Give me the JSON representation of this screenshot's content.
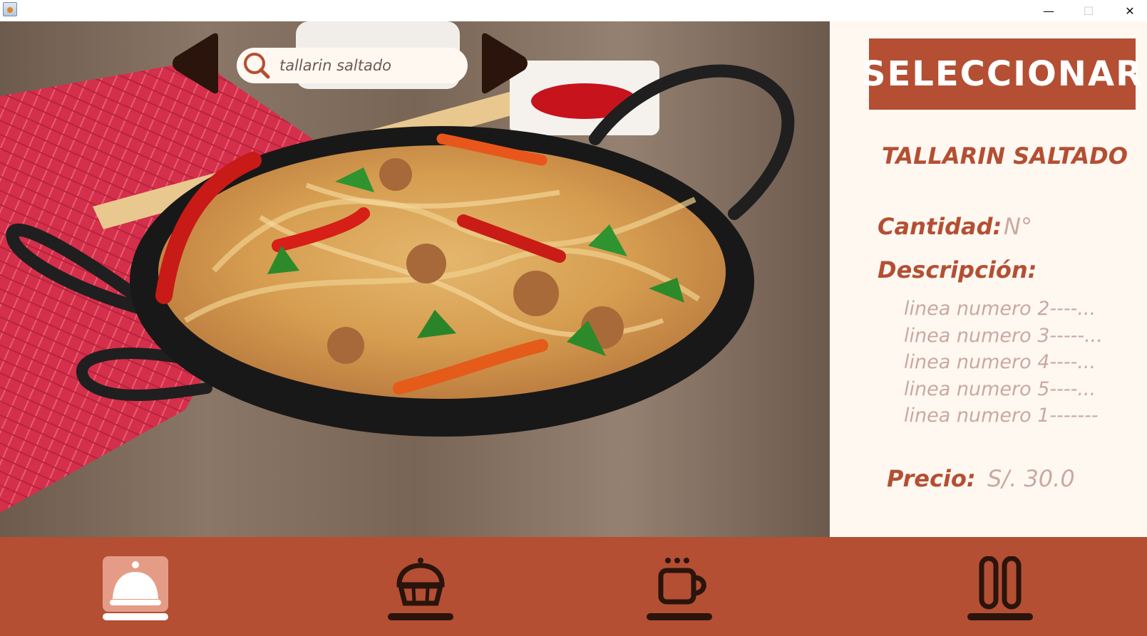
{
  "window": {
    "controls": [
      "minimize",
      "maximize",
      "close"
    ],
    "minimize_glyph": "—",
    "maximize_glyph": "☐",
    "close_glyph": "✕"
  },
  "search": {
    "value": "tallarin saltado",
    "icon": "search-icon"
  },
  "navigation": {
    "prev_icon": "left-arrow-icon",
    "next_icon": "right-arrow-icon"
  },
  "actions": {
    "select_label": "SELECCIONAR"
  },
  "dish": {
    "name": "TALLARIN SALTADO",
    "quantity_label": "Cantidad:",
    "quantity_value": "N°",
    "description_label": "Descripción:",
    "description_lines": [
      "linea numero 2----...",
      "linea numero 3-----...",
      "linea numero 4----...",
      "linea numero 5----...",
      "linea numero 1-------"
    ],
    "price_label": "Precio:",
    "price_value": "S/. 30.0"
  },
  "bottom_nav": [
    {
      "icon": "serving-cloche-icon",
      "active": true
    },
    {
      "icon": "cupcake-icon",
      "active": false
    },
    {
      "icon": "coffee-cup-icon",
      "active": false
    },
    {
      "icon": "drinks-glasses-icon",
      "active": false
    }
  ],
  "colors": {
    "accent": "#b44f33",
    "panel_background": "#fff8f1",
    "muted_text": "#c9a9a0",
    "active_nav_background": "#e59c86",
    "arrow_color": "#2a140c"
  }
}
